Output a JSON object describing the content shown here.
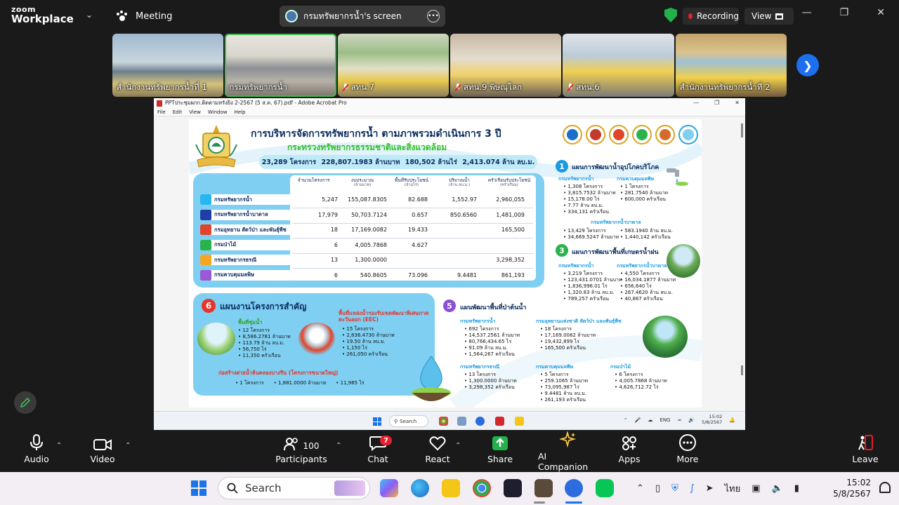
{
  "app": {
    "logo_top": "zoom",
    "logo_bottom": "Workplace",
    "meeting_label": "Meeting",
    "screen_title": "กรมทรัพยากรน้ำ's screen",
    "recording_label": "Recording",
    "view_label": "View",
    "colors": {
      "bg": "#1a1a1a",
      "accent": "#1e6ff0",
      "rec": "#e5202e",
      "green": "#22b14c"
    }
  },
  "participants_strip": [
    {
      "name": "สำนักงานทรัพยากรน้ำที่ 1",
      "muted": false,
      "active": false
    },
    {
      "name": "กรมทรัพยากรน้ำ",
      "muted": false,
      "active": true
    },
    {
      "name": "สทน.7",
      "muted": true,
      "active": false
    },
    {
      "name": "สทน.9 พิษณุโลก",
      "muted": true,
      "active": false
    },
    {
      "name": "สทน.6",
      "muted": true,
      "active": false
    },
    {
      "name": "สำนักงานทรัพยากรน้ำที่ 2",
      "muted": false,
      "active": false
    }
  ],
  "acrobat": {
    "title": "PPTประชุมผกก.ติดตามหรังยิง 2-2567 (5 ส.ค. 67).pdf - Adobe Acrobat Pro",
    "menu": [
      "File",
      "Edit",
      "View",
      "Window",
      "Help"
    ]
  },
  "slide": {
    "title": "การบริหารจัดการทรัพยากรน้ำ ตามภาพรวมดำเนินการ 3 ปี",
    "subtitle": "กระทรวงทรัพยากรธรรมชาติและสิ่งแวดล้อม",
    "summary": [
      "23,289 โครงการ",
      "228,807.1983 ล้านบาท",
      "180,502 ล้านไร่",
      "2,413.074 ล้าน ลบ.ม."
    ],
    "table": {
      "headers": [
        {
          "label": "จำนวนโครงการ",
          "unit": ""
        },
        {
          "label": "งบประมาณ",
          "unit": "(ล้านบาท)"
        },
        {
          "label": "พื้นที่รับประโยชน์",
          "unit": "(ล้านไร่)"
        },
        {
          "label": "ปริมาณน้ำ",
          "unit": "(ล้าน ลบ.ม.)"
        },
        {
          "label": "ครัวเรือนรับประโยชน์",
          "unit": "(ครัวเรือน)"
        }
      ],
      "rows": [
        {
          "dept": "กรมทรัพยากรน้ำ",
          "color": "#27b6ef",
          "c1": "5,247",
          "c2": "155,087.8305",
          "c3": "82.688",
          "c4": "1,552.97",
          "c5": "2,960,055"
        },
        {
          "dept": "กรมทรัพยากรน้ำบาดาล",
          "color": "#1f3fa6",
          "c1": "17,979",
          "c2": "50,703.7124",
          "c3": "0.657",
          "c4": "850.6560",
          "c5": "1,481,009"
        },
        {
          "dept": "กรมอุทยาน สัตว์ป่า และพันธุ์พืช",
          "color": "#e0452b",
          "c1": "18",
          "c2": "17,169.0082",
          "c3": "19.433",
          "c4": "",
          "c5": "165,500"
        },
        {
          "dept": "กรมป่าไม้",
          "color": "#2bb24c",
          "c1": "6",
          "c2": "4,005.7868",
          "c3": "4.627",
          "c4": "",
          "c5": ""
        },
        {
          "dept": "กรมทรัพยากรธรณี",
          "color": "#f5a623",
          "c1": "13",
          "c2": "1,300.0000",
          "c3": "",
          "c4": "",
          "c5": "3,298,352"
        },
        {
          "dept": "กรมควบคุมมลพิษ",
          "color": "#9b59d6",
          "c1": "6",
          "c2": "540.8605",
          "c3": "73.096",
          "c4": "9.4481",
          "c5": "861,193"
        }
      ]
    },
    "sec1": {
      "no": "1",
      "title": "แผนการพัฒนาน้ำอุปโภคบริโภค",
      "a_title": "กรมทรัพยากรน้ำ",
      "a_items": [
        "1,308 โครงการ",
        "3,815.7532 ล้านบาท",
        "15,178.00 ไร่",
        "7.77 ล้าน ลบ.ม.",
        "334,131 ครัวเรือน"
      ],
      "b_title": "กรมควบคุมมลพิษ",
      "b_items": [
        "1 โครงการ",
        "281.7540 ล้านบาท",
        "600,000 ครัวเรือน"
      ],
      "c_title": "กรมทรัพยากรน้ำบาดาล",
      "c_items": [
        "13,429 โครงการ",
        "34,669.5247 ล้านบาท"
      ],
      "c_items2": [
        "583.1940 ล้าน ลบ.ม.",
        "1,440,142 ครัวเรือน"
      ]
    },
    "sec3": {
      "no": "3",
      "title": "แผนการพัฒนาพื้นที่เกษตรน้ำฝน",
      "a_title": "กรมทรัพยากรน้ำ",
      "a_items": [
        "3,219 โครงการ",
        "123,431.0701 ล้านบาท",
        "1,836,996.01 ไร่",
        "1,320.83 ล้าน ลบ.ม.",
        "789,257 ครัวเรือน"
      ],
      "b_title": "กรมทรัพยากรน้ำบาดาล",
      "b_items": [
        "4,550 โครงการ",
        "16,034.1877 ล้านบาท",
        "656,640 ไร่",
        "267.4620 ล้าน ลบ.ม.",
        "40,867 ครัวเรือน"
      ]
    },
    "sec5": {
      "no": "5",
      "title": "แผนพัฒนาพื้นที่ป่าต้นน้ำ",
      "a_title": "กรมทรัพยากรน้ำ",
      "a_items": [
        "692 โครงการ",
        "14,537.2561 ล้านบาท",
        "80,766,434.65 ไร่",
        "91.09 ล้าน ลบ.ม.",
        "1,564,267 ครัวเรือน"
      ],
      "b_title": "กรมอุทยานแห่งชาติ สัตว์ป่า และพันธุ์พืช",
      "b_items": [
        "18 โครงการ",
        "17,169.0082 ล้านบาท",
        "19,432,899 ไร่",
        "165,500 ครัวเรือน"
      ],
      "c_title": "กรมทรัพยากรธรณี",
      "c_items": [
        "13 โครงการ",
        "1,300.0000 ล้านบาท",
        "3,298,352 ครัวเรือน"
      ],
      "d_title": "กรมควบคุมมลพิษ",
      "d_items": [
        "5 โครงการ",
        "259.1065 ล้านบาท",
        "73,095,987 ไร่",
        "9.4481 ล้าน ลบ.ม.",
        "261,193 ครัวเรือน"
      ],
      "e_title": "กรมป่าไม้",
      "e_items": [
        "6 โครงการ",
        "4,005.7868 ล้านบาท",
        "4,626,712.72 ไร่"
      ]
    },
    "sec6": {
      "no": "6",
      "title": "แผนงานโครงการสำคัญ",
      "a_title": "พื้นที่ชุ่มน้ำ",
      "a_items": [
        "12 โครงการ",
        "8,586.2781 ล้านบาท",
        "113.79 ล้าน ลบ.ม.",
        "56,750 ไร่",
        "11,350 ครัวเรือน"
      ],
      "b_title": "พื้นที่แหล่งน้ำรองรับเขตพัฒนาพิเศษภาคตะวันออก (EEC)",
      "b_items": [
        "15 โครงการ",
        "2,836.4730 ล้านบาท",
        "19.50 ล้าน ลบ.ม.",
        "1,150 ไร่",
        "261,050 ครัวเรือน"
      ],
      "c_title": "ก่อสร้างฝายน้ำล้นคลองบางรีน (โครงการขนาดใหญ่)",
      "c_items": [
        "1 โครงการ",
        "1,881.0000 ล้านบาท",
        "11,965 ไร่"
      ]
    }
  },
  "inner_taskbar": {
    "search": "Search",
    "lang": "ENG",
    "time": "15:02",
    "date": "5/8/2567"
  },
  "controls": {
    "audio": "Audio",
    "video": "Video",
    "participants": "Participants",
    "participants_count": "100",
    "chat": "Chat",
    "chat_badge": "7",
    "react": "React",
    "share": "Share",
    "ai": "AI Companion",
    "apps": "Apps",
    "more": "More",
    "leave": "Leave"
  },
  "win_taskbar": {
    "search": "Search",
    "lang": "ไทย",
    "time": "15:02",
    "date": "5/8/2567"
  }
}
